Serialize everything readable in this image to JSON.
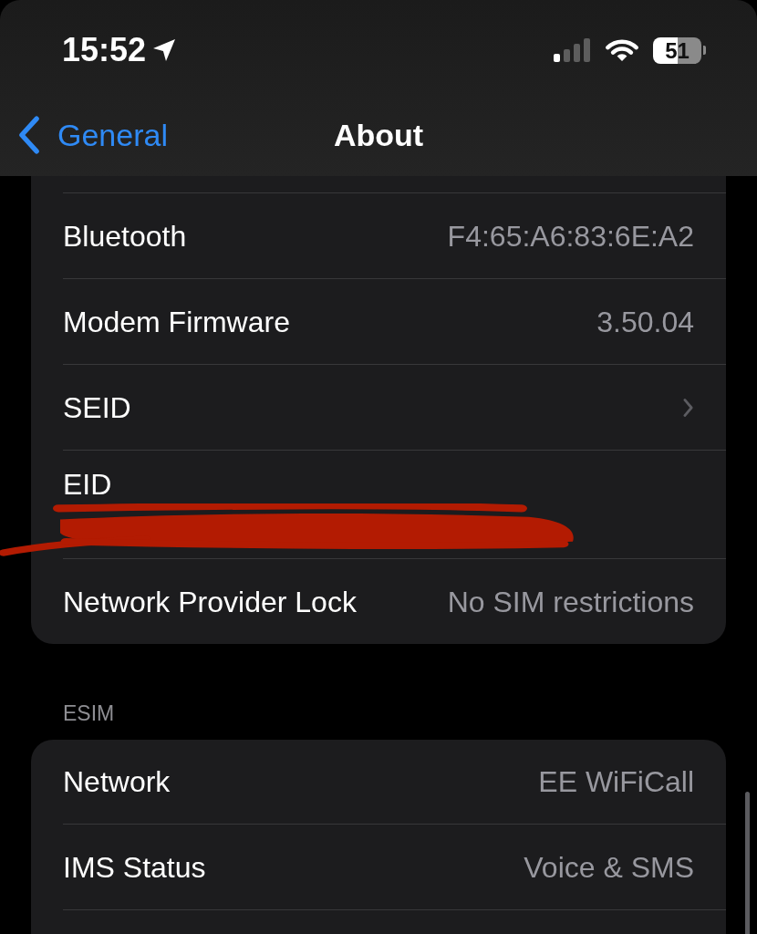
{
  "status_bar": {
    "time": "15:52",
    "battery": "51"
  },
  "nav": {
    "back": "General",
    "title": "About"
  },
  "sections": [
    {
      "rows": [
        {
          "kind": "value",
          "label": "Bluetooth",
          "value": "F4:65:A6:83:6E:A2"
        },
        {
          "kind": "value",
          "label": "Modem Firmware",
          "value": "3.50.04"
        },
        {
          "kind": "link",
          "label": "SEID"
        },
        {
          "kind": "redacted",
          "label": "EID"
        },
        {
          "kind": "value",
          "label": "Network Provider Lock",
          "value": "No SIM restrictions"
        }
      ]
    },
    {
      "header": "ESIM",
      "rows": [
        {
          "kind": "value",
          "label": "Network",
          "value": "EE WiFiCall"
        },
        {
          "kind": "value",
          "label": "IMS Status",
          "value": "Voice & SMS"
        }
      ]
    }
  ]
}
